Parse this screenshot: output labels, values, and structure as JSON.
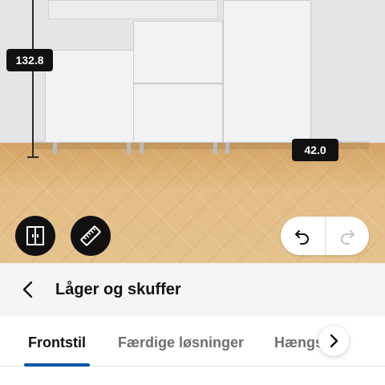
{
  "scene": {
    "dimension_height": "132.8",
    "dimension_depth": "42.0",
    "doors_toggle_icon": "doors-icon",
    "measure_icon": "ruler-icon",
    "undo_icon": "undo-icon",
    "redo_icon": "redo-icon"
  },
  "header": {
    "back_icon": "chevron-left-icon",
    "title": "Låger og skuffer"
  },
  "tabs": {
    "items": [
      {
        "label": "Frontstil",
        "active": true
      },
      {
        "label": "Færdige løsninger",
        "active": false
      },
      {
        "label": "Hængslur",
        "active": false
      }
    ],
    "scroll_icon": "chevron-right-icon"
  },
  "colors": {
    "accent": "#0058a3",
    "dark": "#111111"
  }
}
